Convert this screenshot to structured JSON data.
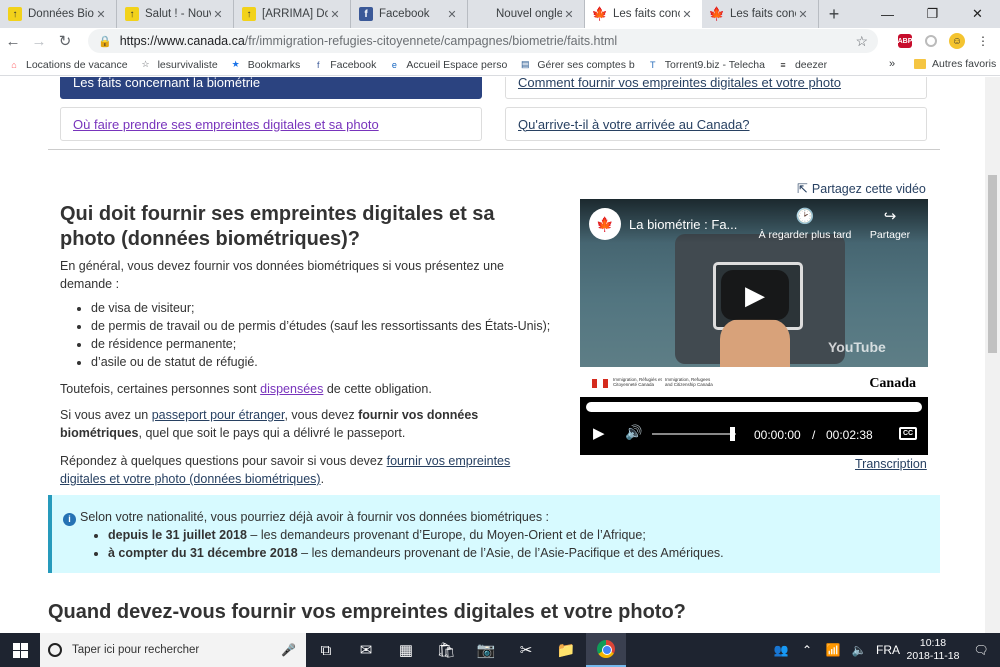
{
  "browser": {
    "tabs": [
      {
        "label": "Données Biomé",
        "fav": "yellow",
        "fav_glyph": "↑"
      },
      {
        "label": "Salut ! - Nouvea",
        "fav": "yellow",
        "fav_glyph": "↑"
      },
      {
        "label": "[ARRIMA] Dom",
        "fav": "yellow",
        "fav_glyph": "↑"
      },
      {
        "label": "Facebook",
        "fav": "fb",
        "fav_glyph": "f"
      },
      {
        "label": "Nouvel onglet",
        "fav": "none",
        "fav_glyph": ""
      },
      {
        "label": "Les faits concer",
        "fav": "leaf",
        "fav_glyph": "🍁"
      },
      {
        "label": "Les faits concer",
        "fav": "leaf",
        "fav_glyph": "🍁"
      }
    ],
    "active_tab": 5,
    "newtab": "+",
    "url_host": "https://www.canada.ca",
    "url_path": "/fr/immigration-refugies-citoyennete/campagnes/biometrie/faits.html",
    "abp_badge": "ABP",
    "bookmarks": [
      {
        "label": "Locations de vacance",
        "icon": "airbnb-icon",
        "glyph": "⌂",
        "color": "#ff5a5f"
      },
      {
        "label": "lesurvivaliste",
        "icon": "star-outline-icon",
        "glyph": "☆",
        "color": "#5f6368"
      },
      {
        "label": "Bookmarks",
        "icon": "star-icon",
        "glyph": "★",
        "color": "#1a73e8"
      },
      {
        "label": "Facebook",
        "icon": "facebook-icon",
        "glyph": "f",
        "color": "#3b5998"
      },
      {
        "label": "Accueil Espace perso",
        "icon": "globe-icon",
        "glyph": "e",
        "color": "#1565c0"
      },
      {
        "label": "Gérer ses comptes b",
        "icon": "bank-icon",
        "glyph": "▤",
        "color": "#1b4f8a"
      },
      {
        "label": "Torrent9.biz - Telecha",
        "icon": "torrent-icon",
        "glyph": "T",
        "color": "#2a6ebb"
      },
      {
        "label": "deezer",
        "icon": "deezer-icon",
        "glyph": "≡",
        "color": "#222"
      }
    ],
    "bookmarks_more": "»",
    "other_bookmarks": "Autres favoris"
  },
  "page": {
    "toc": {
      "active": "Les faits concernant la biométrie",
      "link_where": "Où faire prendre ses empreintes digitales et sa photo",
      "link_how": "Comment fournir vos empreintes digitales et votre photo",
      "link_arrival": "Qu'arrive-t-il à votre arrivée au Canada?"
    },
    "heading": "Qui doit fournir ses empreintes digitales et sa photo (données biométriques)?",
    "intro": "En général, vous devez fournir vos données biométriques si vous présentez une demande :",
    "list": [
      "de visa de visiteur;",
      "de permis de travail ou de permis d’études (sauf les ressortissants des États-Unis);",
      "de résidence permanente;",
      "d’asile ou de statut de réfugié."
    ],
    "exempt_pre": "Toutefois, certaines personnes sont ",
    "exempt_link": "dispensées",
    "exempt_post": " de cette obligation.",
    "passport_pre": "Si vous avez un ",
    "passport_link": "passeport pour étranger",
    "passport_mid": ", vous devez ",
    "passport_bold": "fournir vos données biométriques",
    "passport_post": ", quel que soit le pays qui a délivré le passeport.",
    "questions_pre": "Répondez à quelques questions pour savoir si vous devez ",
    "questions_link": "fournir vos empreintes digitales et votre photo (données biométriques)",
    "questions_post": ".",
    "alert": {
      "intro": "Selon votre nationalité, vous pourriez déjà avoir à fournir vos données biométriques :",
      "item1_bold": "depuis le 31 juillet 2018",
      "item1_rest": " – les demandeurs provenant d’Europe, du Moyen-Orient et de l’Afrique;",
      "item2_bold": "à compter du 31 décembre 2018",
      "item2_rest": " – les demandeurs provenant de l’Asie, de l’Asie-Pacifique et des Amériques."
    },
    "heading2": "Quand devez-vous fournir vos empreintes digitales et votre photo?"
  },
  "video": {
    "share_label": "Partagez cette vidéo",
    "title": "La biométrie : Fa...",
    "watch_later": "À regarder plus tard",
    "share": "Partager",
    "channel_logo": "Canada",
    "youtube": "YouTube",
    "dept_fr": "Immigration, Réfugiés et Citoyenneté Canada",
    "dept_en": "Immigration, Refugees and Citizenship Canada",
    "wordmark": "Canada",
    "current_time": "00:00:00",
    "separator": "/",
    "duration": "00:02:38",
    "cc": "CC",
    "volume_fraction": 0.96,
    "progress_fraction": 0,
    "transcript": "Transcription"
  },
  "taskbar": {
    "search_placeholder": "Taper ici pour rechercher",
    "lang": "FRA",
    "time": "10:18",
    "date": "2018-11-18"
  }
}
